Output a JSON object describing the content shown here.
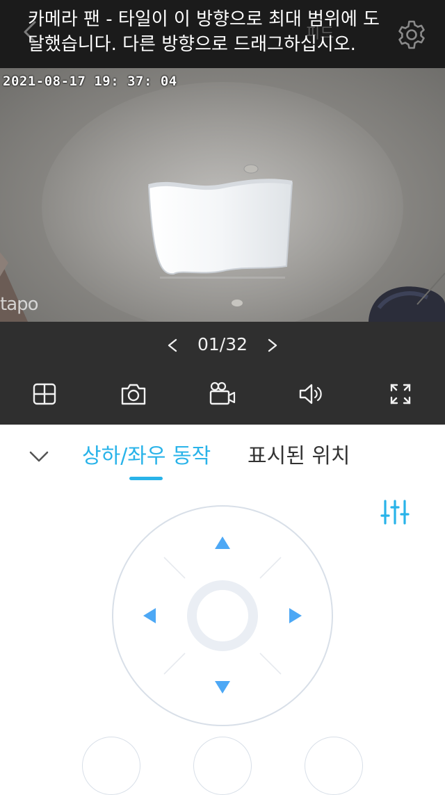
{
  "header": {
    "background_title": "피드",
    "message": "카메라 팬 - 타일이 이 방향으로 최대 범위에 도달했습니다. 다른 방향으로 드래그하십시오.",
    "back_icon": "chevron-left-icon",
    "settings_icon": "gear-icon"
  },
  "video": {
    "timestamp": "2021-08-17  19: 37: 04",
    "watermark": "tapo"
  },
  "pager": {
    "count": "01/32",
    "prev_icon": "chevron-left-icon",
    "next_icon": "chevron-right-icon"
  },
  "toolbar": {
    "items": [
      "grid-view-icon",
      "camera-icon",
      "video-record-icon",
      "speaker-icon",
      "fullscreen-icon"
    ]
  },
  "tabs": {
    "items": [
      {
        "label": "상하/좌우 동작",
        "active": true
      },
      {
        "label": "표시된 위치",
        "active": false
      }
    ]
  },
  "colors": {
    "accent": "#29b3e9",
    "arrow": "#4da8f5",
    "banner_bg": "#1b1b1b",
    "strip_bg": "#2f2f2f"
  }
}
